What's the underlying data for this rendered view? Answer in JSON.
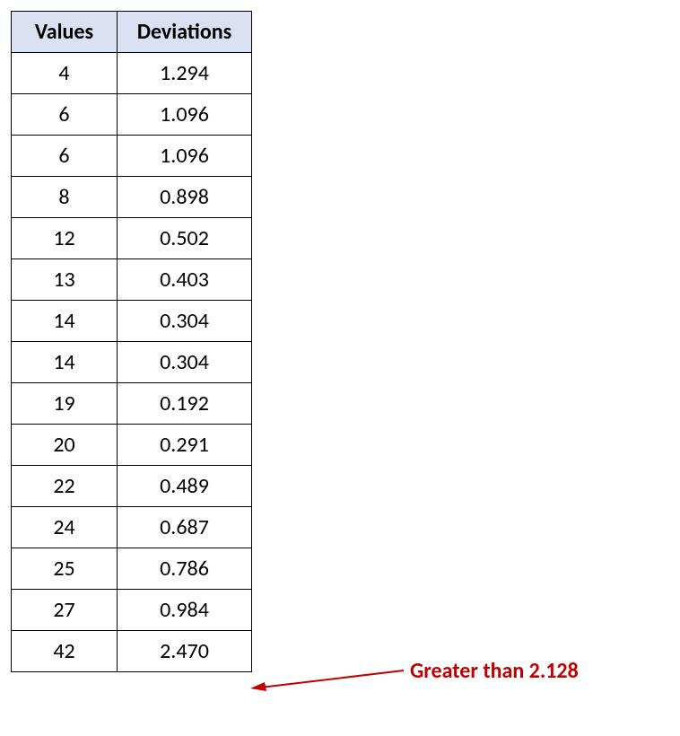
{
  "chart_data": {
    "type": "table",
    "title": "",
    "columns": [
      "Values",
      "Deviations"
    ],
    "rows": [
      {
        "value": "4",
        "deviation": "1.294"
      },
      {
        "value": "6",
        "deviation": "1.096"
      },
      {
        "value": "6",
        "deviation": "1.096"
      },
      {
        "value": "8",
        "deviation": "0.898"
      },
      {
        "value": "12",
        "deviation": "0.502"
      },
      {
        "value": "13",
        "deviation": "0.403"
      },
      {
        "value": "14",
        "deviation": "0.304"
      },
      {
        "value": "14",
        "deviation": "0.304"
      },
      {
        "value": "19",
        "deviation": "0.192"
      },
      {
        "value": "20",
        "deviation": "0.291"
      },
      {
        "value": "22",
        "deviation": "0.489"
      },
      {
        "value": "24",
        "deviation": "0.687"
      },
      {
        "value": "25",
        "deviation": "0.786"
      },
      {
        "value": "27",
        "deviation": "0.984"
      },
      {
        "value": "42",
        "deviation": "2.470"
      }
    ],
    "annotation": "Greater than 2.128"
  }
}
